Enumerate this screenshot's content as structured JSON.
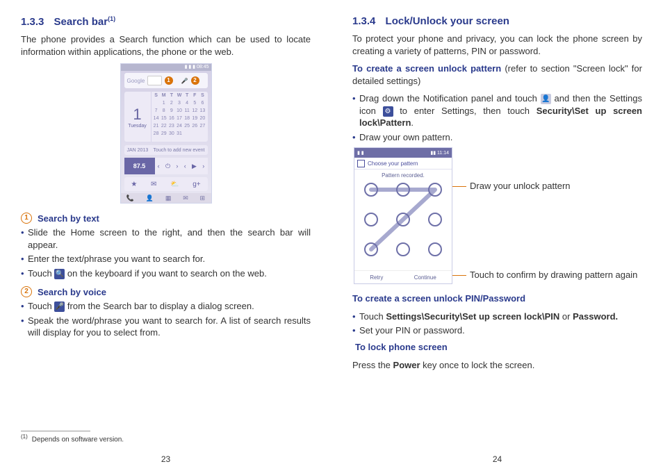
{
  "left": {
    "sec_num": "1.3.3",
    "sec_title": "Search bar",
    "sec_sup": "(1)",
    "intro": "The phone provides a Search function which can be used to locate information within applications, the phone or the web.",
    "thumb": {
      "statusbar_time": "08:45",
      "searchbar_label": "Google",
      "cal_bignum": "1",
      "cal_day": "Tuesday",
      "cal_header": [
        "S",
        "M",
        "T",
        "W",
        "T",
        "F",
        "S"
      ],
      "cal_grid": [
        "",
        "1",
        "2",
        "3",
        "4",
        "5",
        "6",
        "7",
        "8",
        "9",
        "10",
        "11",
        "12",
        "13",
        "14",
        "15",
        "16",
        "17",
        "18",
        "19",
        "20",
        "21",
        "22",
        "23",
        "24",
        "25",
        "26",
        "27",
        "28",
        "29",
        "30",
        "31",
        "",
        "",
        ""
      ],
      "info_left": "JAN 2013",
      "info_right": "Touch to add new event",
      "radio_label": "87.5",
      "ctrl_icons": [
        "‹",
        "⏻",
        "›",
        "‹",
        "▶",
        "›"
      ],
      "app_icons": [
        "★",
        "✉",
        "⛅",
        "g+"
      ],
      "dock_icons": [
        "📞",
        "👤",
        "▦",
        "✉",
        "⊞"
      ],
      "callouts": {
        "one": "1",
        "two": "2"
      }
    },
    "sub1_num": "1",
    "sub1_title": "Search by text",
    "sub1_bullets": [
      "Slide the Home screen to the right, and then the search bar will appear.",
      "Enter the text/phrase you want to search for.",
      {
        "pre": "Touch ",
        "icon": "🔍",
        "post": " on the keyboard if you want to search on the web."
      }
    ],
    "sub2_num": "2",
    "sub2_title": "Search by voice",
    "sub2_bullets": [
      {
        "pre": "Touch ",
        "icon": "🎤",
        "post": " from the Search bar to display a dialog screen."
      },
      "Speak the word/phrase you want to search for. A list of search results will display for you to select from."
    ],
    "footnote_mark": "(1)",
    "footnote_text": "Depends on software version.",
    "pagenum": "23"
  },
  "right": {
    "sec_num": "1.3.4",
    "sec_title": "Lock/Unlock your screen",
    "intro": "To protect your phone and privacy, you can lock the phone screen by creating a variety of patterns, PIN or password.",
    "create_pattern_bold": "To create a screen unlock pattern",
    "create_pattern_rest": " (refer to section \"Screen lock\" for detailed settings)",
    "pattern_bullets": {
      "b1_pre": "Drag down the Notification panel and touch ",
      "b1_icon1": "👤",
      "b1_mid": " and then the Settings icon ",
      "b1_icon2": "⚙",
      "b1_mid2": " to enter Settings, then touch ",
      "b1_bold": "Security\\Set up screen lock\\Pattern",
      "b1_end": ".",
      "b2": "Draw your own pattern."
    },
    "pattern_fig": {
      "topbar_right": "11:14",
      "head": "Choose your pattern",
      "sub": "Pattern recorded.",
      "foot_left": "Retry",
      "foot_right": "Continue"
    },
    "annot1": "Draw your unlock pattern",
    "annot2": "Touch to confirm by drawing pattern again",
    "pin_head": "To create a screen unlock PIN/Password",
    "pin_bullets": {
      "b1_pre": "Touch ",
      "b1_bold": "Settings\\Security\\Set up screen lock\\PIN",
      "b1_mid": " or ",
      "b1_bold2": "Password.",
      "b2": "Set your PIN or password."
    },
    "lock_head": "To lock phone screen",
    "lock_body_pre": "Press the ",
    "lock_body_bold": "Power",
    "lock_body_post": " key once to lock the screen.",
    "pagenum": "24"
  }
}
